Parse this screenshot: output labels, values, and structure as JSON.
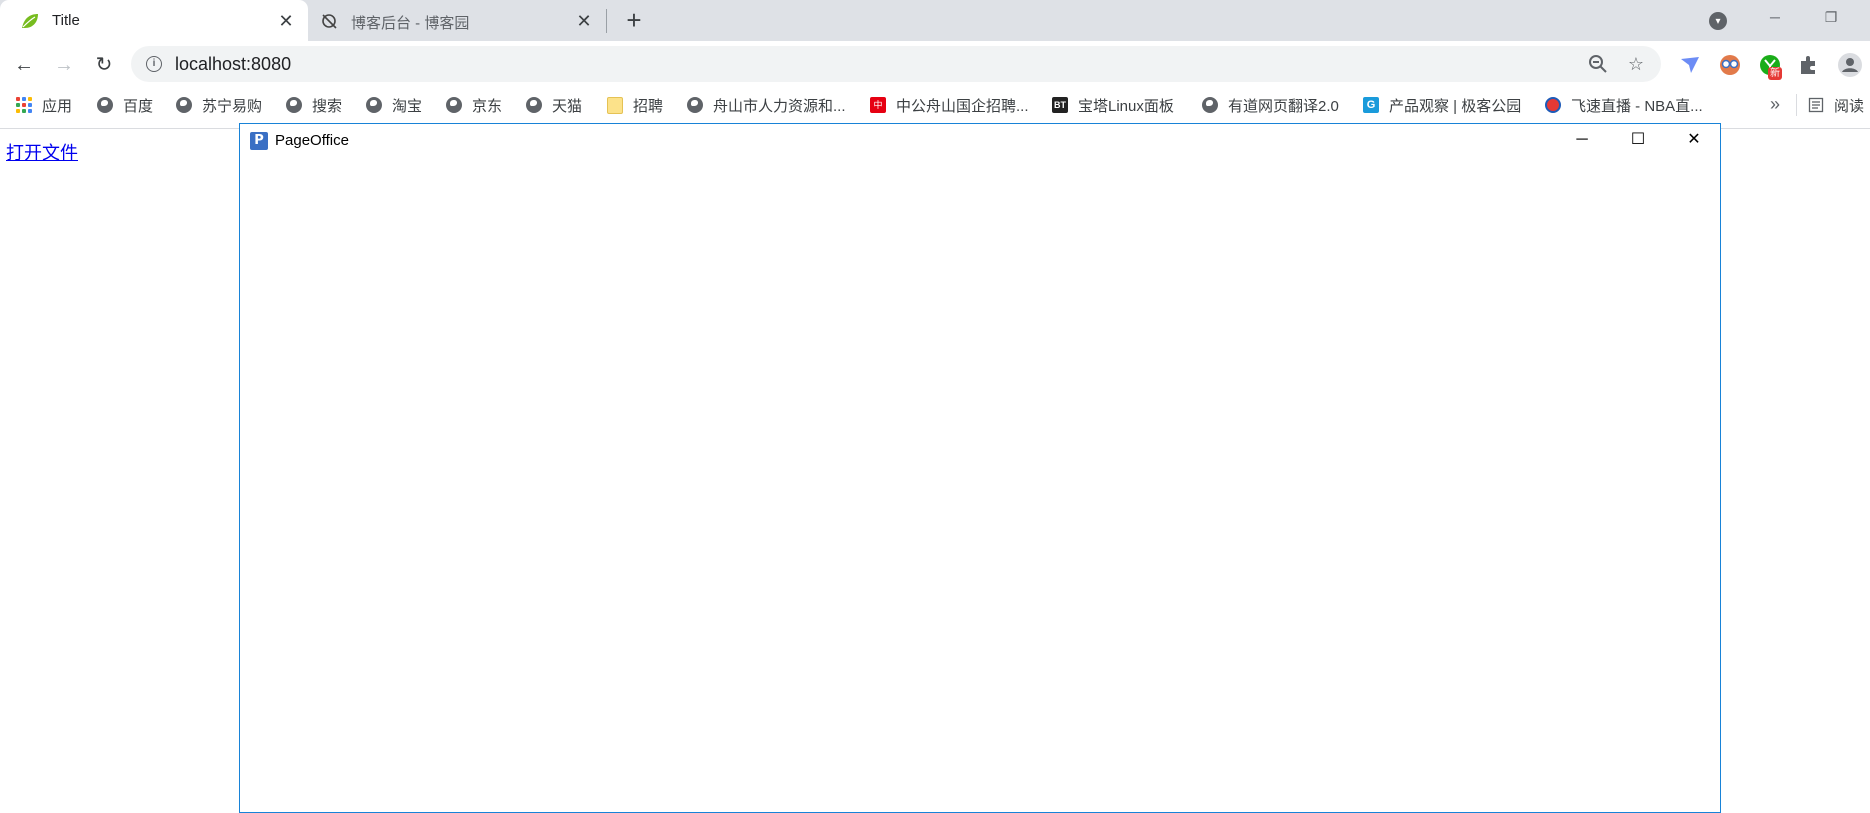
{
  "tabs": [
    {
      "title": "Title",
      "active": true,
      "icon": "spring-leaf-icon"
    },
    {
      "title": "博客后台 - 博客园",
      "active": false,
      "icon": "cnblogs-icon"
    }
  ],
  "tab_close_glyph": "✕",
  "new_tab_glyph": "+",
  "address_bar": {
    "url": "localhost:8080"
  },
  "bookmarks": [
    {
      "label": "应用",
      "icon": "apps-grid-icon"
    },
    {
      "label": "百度",
      "icon": "globe-icon"
    },
    {
      "label": "苏宁易购",
      "icon": "globe-icon"
    },
    {
      "label": "搜索",
      "icon": "globe-icon"
    },
    {
      "label": "淘宝",
      "icon": "globe-icon"
    },
    {
      "label": "京东",
      "icon": "globe-icon"
    },
    {
      "label": "天猫",
      "icon": "globe-icon"
    },
    {
      "label": "招聘",
      "icon": "folder-icon"
    },
    {
      "label": "舟山市人力资源和...",
      "icon": "globe-icon"
    },
    {
      "label": "中公舟山国企招聘...",
      "icon": "offcn-icon"
    },
    {
      "label": "宝塔Linux面板",
      "icon": "bt-icon"
    },
    {
      "label": "有道网页翻译2.0",
      "icon": "globe-icon"
    },
    {
      "label": "产品观察 | 极客公园",
      "icon": "geekpark-icon"
    },
    {
      "label": "飞速直播 - NBA直...",
      "icon": "basketball-icon"
    }
  ],
  "bookmarks_overflow": "»",
  "reading_list": "阅读",
  "extension_badge": "新",
  "page": {
    "link_text": "打开文件"
  },
  "popup": {
    "title": "PageOffice",
    "logo_letter": "P"
  },
  "colors": {
    "tabstrip": "#dee1e6",
    "link": "#0000ee",
    "window_border": "#1883d7"
  }
}
